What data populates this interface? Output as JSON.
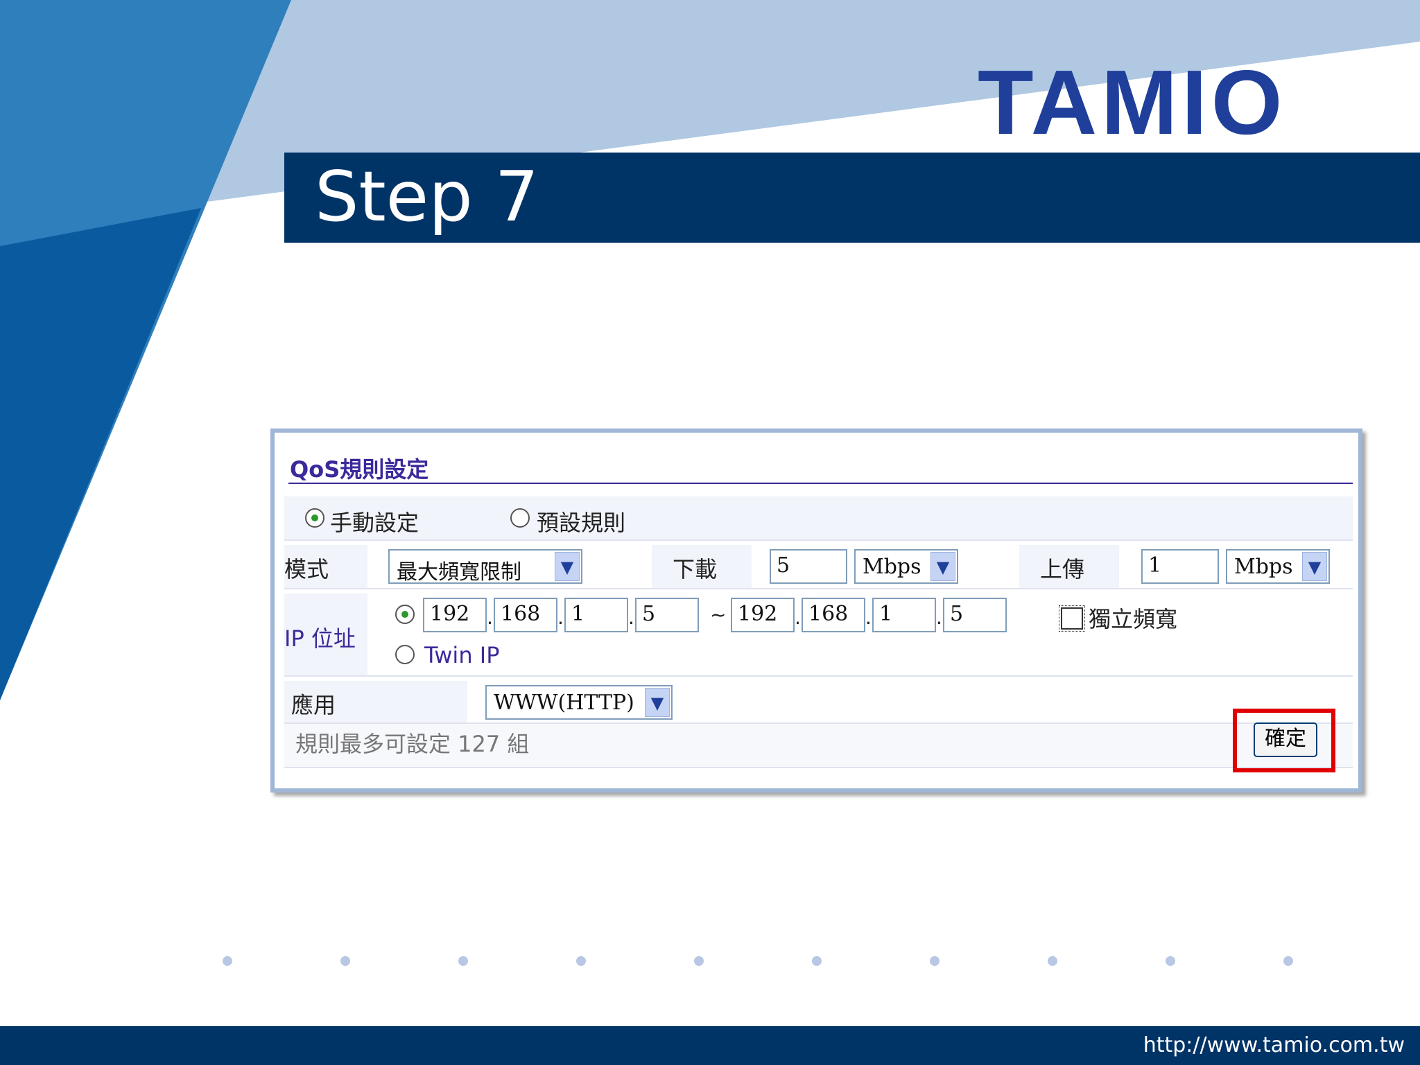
{
  "slide": {
    "title": "Step 7",
    "logo": "TAMIO",
    "footer_url": "http://www.tamio.com.tw",
    "colors": {
      "navy": "#003366",
      "logo_blue": "#1f3f9a",
      "highlight_red": "#e00000"
    }
  },
  "qos": {
    "title": "QoS規則設定",
    "mode_radio": {
      "manual": "手動設定",
      "preset": "預設規則",
      "selected": "manual"
    },
    "mode_label": "模式",
    "mode_select": "最大頻寬限制",
    "download_label": "下載",
    "download_value": "5",
    "download_unit": "Mbps",
    "upload_label": "上傳",
    "upload_value": "1",
    "upload_unit": "Mbps",
    "ip_label": "IP 位址",
    "ip_start": [
      "192",
      "168",
      "1",
      "5"
    ],
    "ip_end": [
      "192",
      "168",
      "1",
      "5"
    ],
    "ip_range_sep": "~",
    "twin_ip": "Twin IP",
    "dedicated_bandwidth": "獨立頻寬",
    "app_label": "應用",
    "app_select": "WWW(HTTP)",
    "hint": "規則最多可設定 127 組",
    "confirm_button": "確定"
  }
}
